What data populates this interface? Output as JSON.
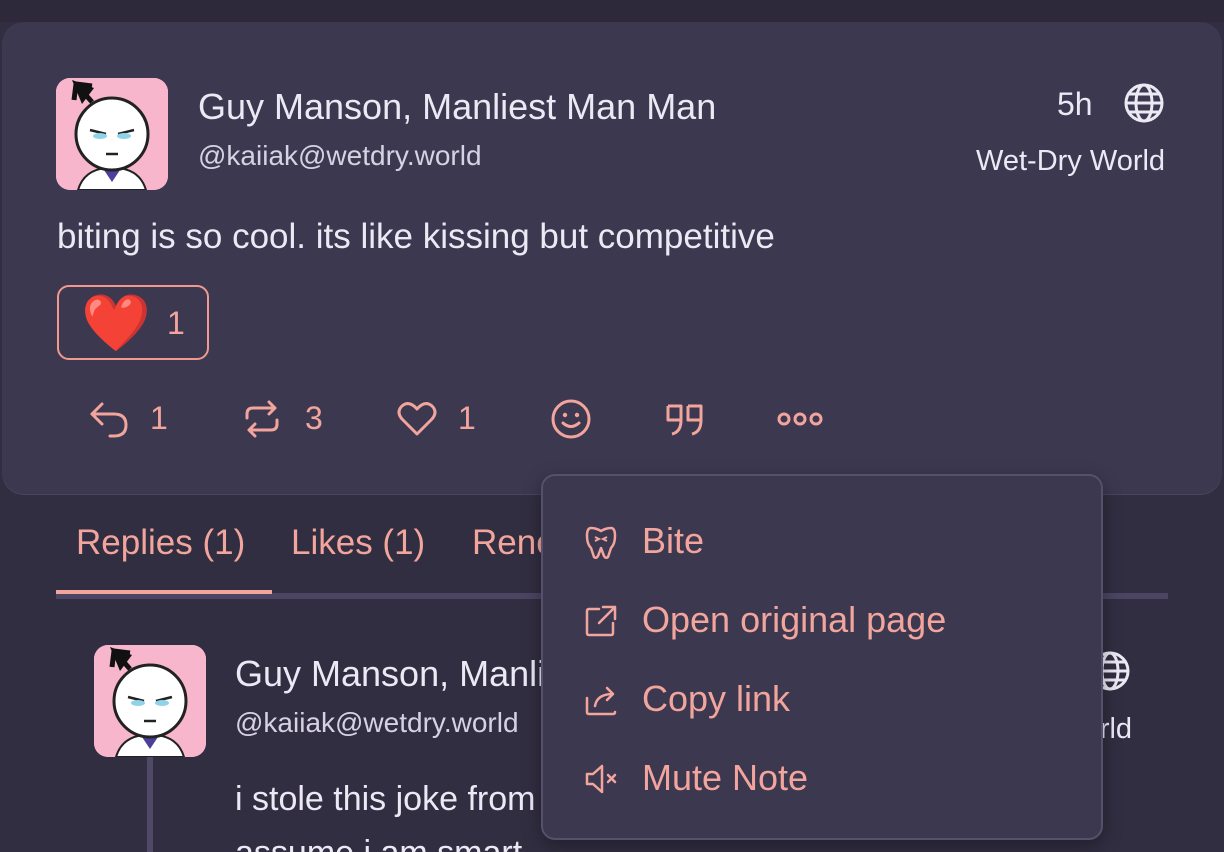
{
  "post": {
    "author_name": "Guy Manson, Manliest Man Man",
    "handle": "@kaiiak@wetdry.world",
    "time": "5h",
    "instance": "Wet-Dry World",
    "text": "biting is so cool. its like kissing but competitive",
    "reaction": {
      "emoji": "❤️",
      "count": "1"
    },
    "actions": {
      "reply_count": "1",
      "renote_count": "3",
      "like_count": "1"
    }
  },
  "tabs": {
    "replies": "Replies (1)",
    "likes": "Likes (1)",
    "renotes": "Renotes"
  },
  "reply": {
    "author_name": "Guy Manson, Manliest Man Man",
    "handle": "@kaiiak@wetdry.world",
    "instance": "Wet-Dry World",
    "text_line1": "i stole this joke from",
    "text_line2": "assume i am smart"
  },
  "menu": {
    "items": [
      {
        "label": "Bite",
        "icon": "tooth-icon"
      },
      {
        "label": "Open original page",
        "icon": "external-link-icon"
      },
      {
        "label": "Copy link",
        "icon": "share-icon"
      },
      {
        "label": "Mute Note",
        "icon": "volume-mute-icon"
      }
    ]
  },
  "colors": {
    "accent": "#f2a59c",
    "card": "#3c3850",
    "background": "#322e42",
    "avatar_bg": "#f7b6cc"
  }
}
